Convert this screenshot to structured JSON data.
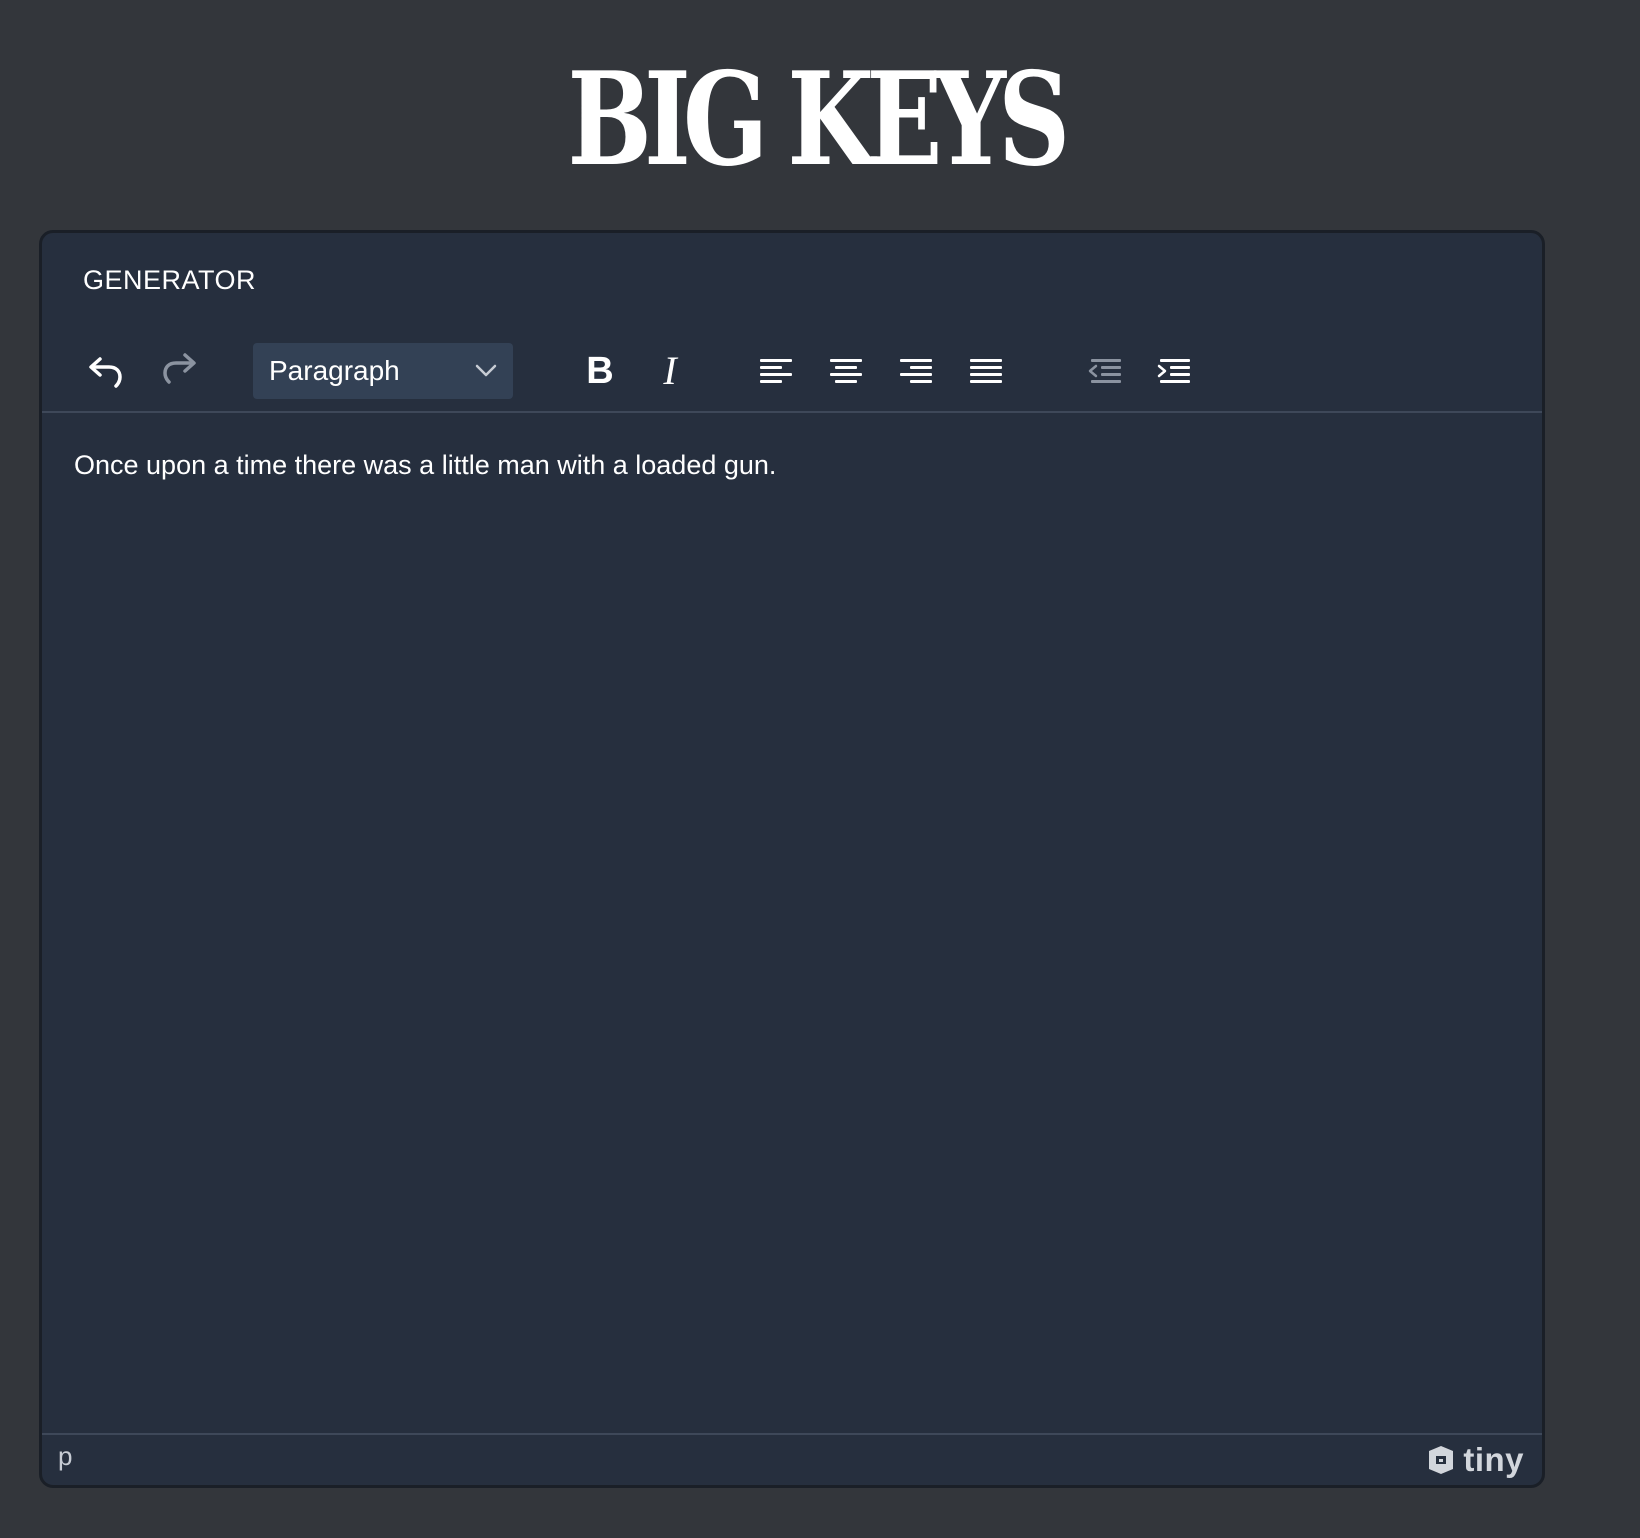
{
  "logo": {
    "text": "BIG KEYS"
  },
  "editor": {
    "title": "GENERATOR",
    "toolbar": {
      "block_format": "Paragraph",
      "buttons": [
        "undo-icon",
        "redo-icon",
        "bold-icon",
        "italic-icon",
        "align-left-icon",
        "align-center-icon",
        "align-right-icon",
        "align-justify-icon",
        "outdent-icon",
        "indent-icon"
      ]
    },
    "content": "Once upon a time there was a little man with a loaded gun.",
    "status": {
      "path": "p",
      "branding": "tiny"
    }
  },
  "colors": {
    "page_background": "#33363b",
    "editor_background": "#262f3e",
    "select_background": "#334155",
    "text": "#ffffff",
    "disabled_icon": "#8b93a0"
  }
}
